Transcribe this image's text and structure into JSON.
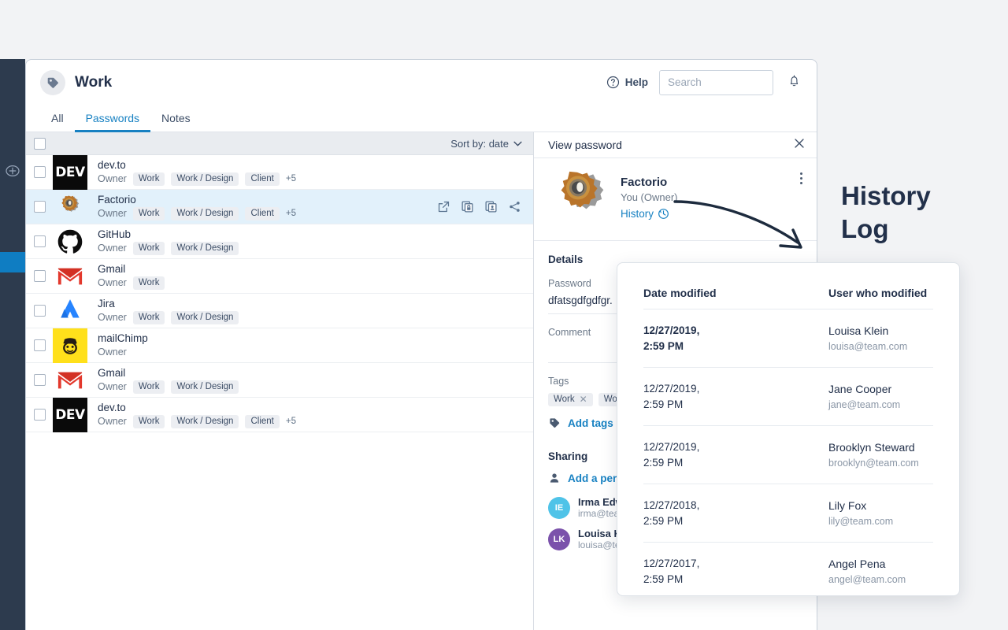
{
  "app": {
    "brand_icon": "tag-icon",
    "title": "Work",
    "help_label": "Help",
    "search_placeholder": "Search",
    "search_value": "",
    "bell_icon": "bell-icon",
    "rail_add_icon": "plus-circle-icon"
  },
  "tabs": [
    {
      "label": "All",
      "active": false
    },
    {
      "label": "Passwords",
      "active": true
    },
    {
      "label": "Notes",
      "active": false
    }
  ],
  "list": {
    "sort_label": "Sort by: date",
    "owner_label": "Owner",
    "row_actions": [
      {
        "icon": "external-link-icon",
        "name": "open-website-icon"
      },
      {
        "icon": "copy-password-icon",
        "name": "copy-password-icon"
      },
      {
        "icon": "copy-login-icon",
        "name": "copy-login-icon"
      },
      {
        "icon": "share-icon",
        "name": "share-icon"
      }
    ],
    "rows": [
      {
        "name": "dev.to",
        "logo": "dev-to",
        "owner": "Owner",
        "tags": [
          "Work",
          "Work / Design",
          "Client"
        ],
        "more": "+5",
        "selected": false
      },
      {
        "name": "Factorio",
        "logo": "factorio",
        "owner": "Owner",
        "tags": [
          "Work",
          "Work / Design",
          "Client"
        ],
        "more": "+5",
        "selected": true
      },
      {
        "name": "GitHub",
        "logo": "github",
        "owner": "Owner",
        "tags": [
          "Work",
          "Work / Design"
        ],
        "more": "",
        "selected": false
      },
      {
        "name": "Gmail",
        "logo": "gmail",
        "owner": "Owner",
        "tags": [
          "Work"
        ],
        "more": "",
        "selected": false
      },
      {
        "name": "Jira",
        "logo": "jira",
        "owner": "Owner",
        "tags": [
          "Work",
          "Work / Design"
        ],
        "more": "",
        "selected": false
      },
      {
        "name": "mailChimp",
        "logo": "mailchimp",
        "owner": "Owner",
        "tags": [],
        "more": "",
        "selected": false
      },
      {
        "name": "Gmail",
        "logo": "gmail",
        "owner": "Owner",
        "tags": [
          "Work",
          "Work / Design"
        ],
        "more": "",
        "selected": false
      },
      {
        "name": "dev.to",
        "logo": "dev-to",
        "owner": "Owner",
        "tags": [
          "Work",
          "Work / Design",
          "Client"
        ],
        "more": "+5",
        "selected": false
      }
    ]
  },
  "detail": {
    "panel_title": "View password",
    "close_icon": "close-icon",
    "item_name": "Factorio",
    "item_owner": "You (Owner)",
    "history_link": "History",
    "history_icon": "clock-history-icon",
    "kebab_icon": "more-vertical-icon",
    "details_heading": "Details",
    "password_label": "Password",
    "password_value": "dfatsgdfgdfgr.",
    "comment_label": "Comment",
    "comment_value": "",
    "tags_label": "Tags",
    "tags": [
      "Work",
      "Work"
    ],
    "add_tags_label": "Add tags",
    "add_tags_icon": "tag-icon",
    "sharing_heading": "Sharing",
    "add_person_label": "Add a person",
    "add_person_icon": "person-icon",
    "people": [
      {
        "initials": "IE",
        "name": "Irma Edwards",
        "email": "irma@team.com",
        "color": "#4fc3e8"
      },
      {
        "initials": "LK",
        "name": "Louisa Klein",
        "email": "louisa@team.com",
        "color": "#7b52ab"
      }
    ]
  },
  "history": {
    "columns": [
      "Date modified",
      "User who modified"
    ],
    "entries": [
      {
        "date": "12/27/2019,",
        "time": "2:59 PM",
        "user": "Louisa Klein",
        "email": "louisa@team.com"
      },
      {
        "date": "12/27/2019,",
        "time": "2:59 PM",
        "user": "Jane Cooper",
        "email": "jane@team.com"
      },
      {
        "date": "12/27/2019,",
        "time": "2:59 PM",
        "user": "Brooklyn Steward",
        "email": "brooklyn@team.com"
      },
      {
        "date": "12/27/2018,",
        "time": "2:59 PM",
        "user": "Lily Fox",
        "email": "lily@team.com"
      },
      {
        "date": "12/27/2017,",
        "time": "2:59 PM",
        "user": "Angel Pena",
        "email": "angel@team.com"
      }
    ]
  },
  "callout": {
    "line1": "History",
    "line2": "Log"
  },
  "colors": {
    "accent": "#1781c2",
    "rail": "#2d3b4e",
    "rail_active": "#0f7dc2",
    "selected_row": "#e2f1fb",
    "text": "#22304a",
    "muted": "#6b7888"
  }
}
